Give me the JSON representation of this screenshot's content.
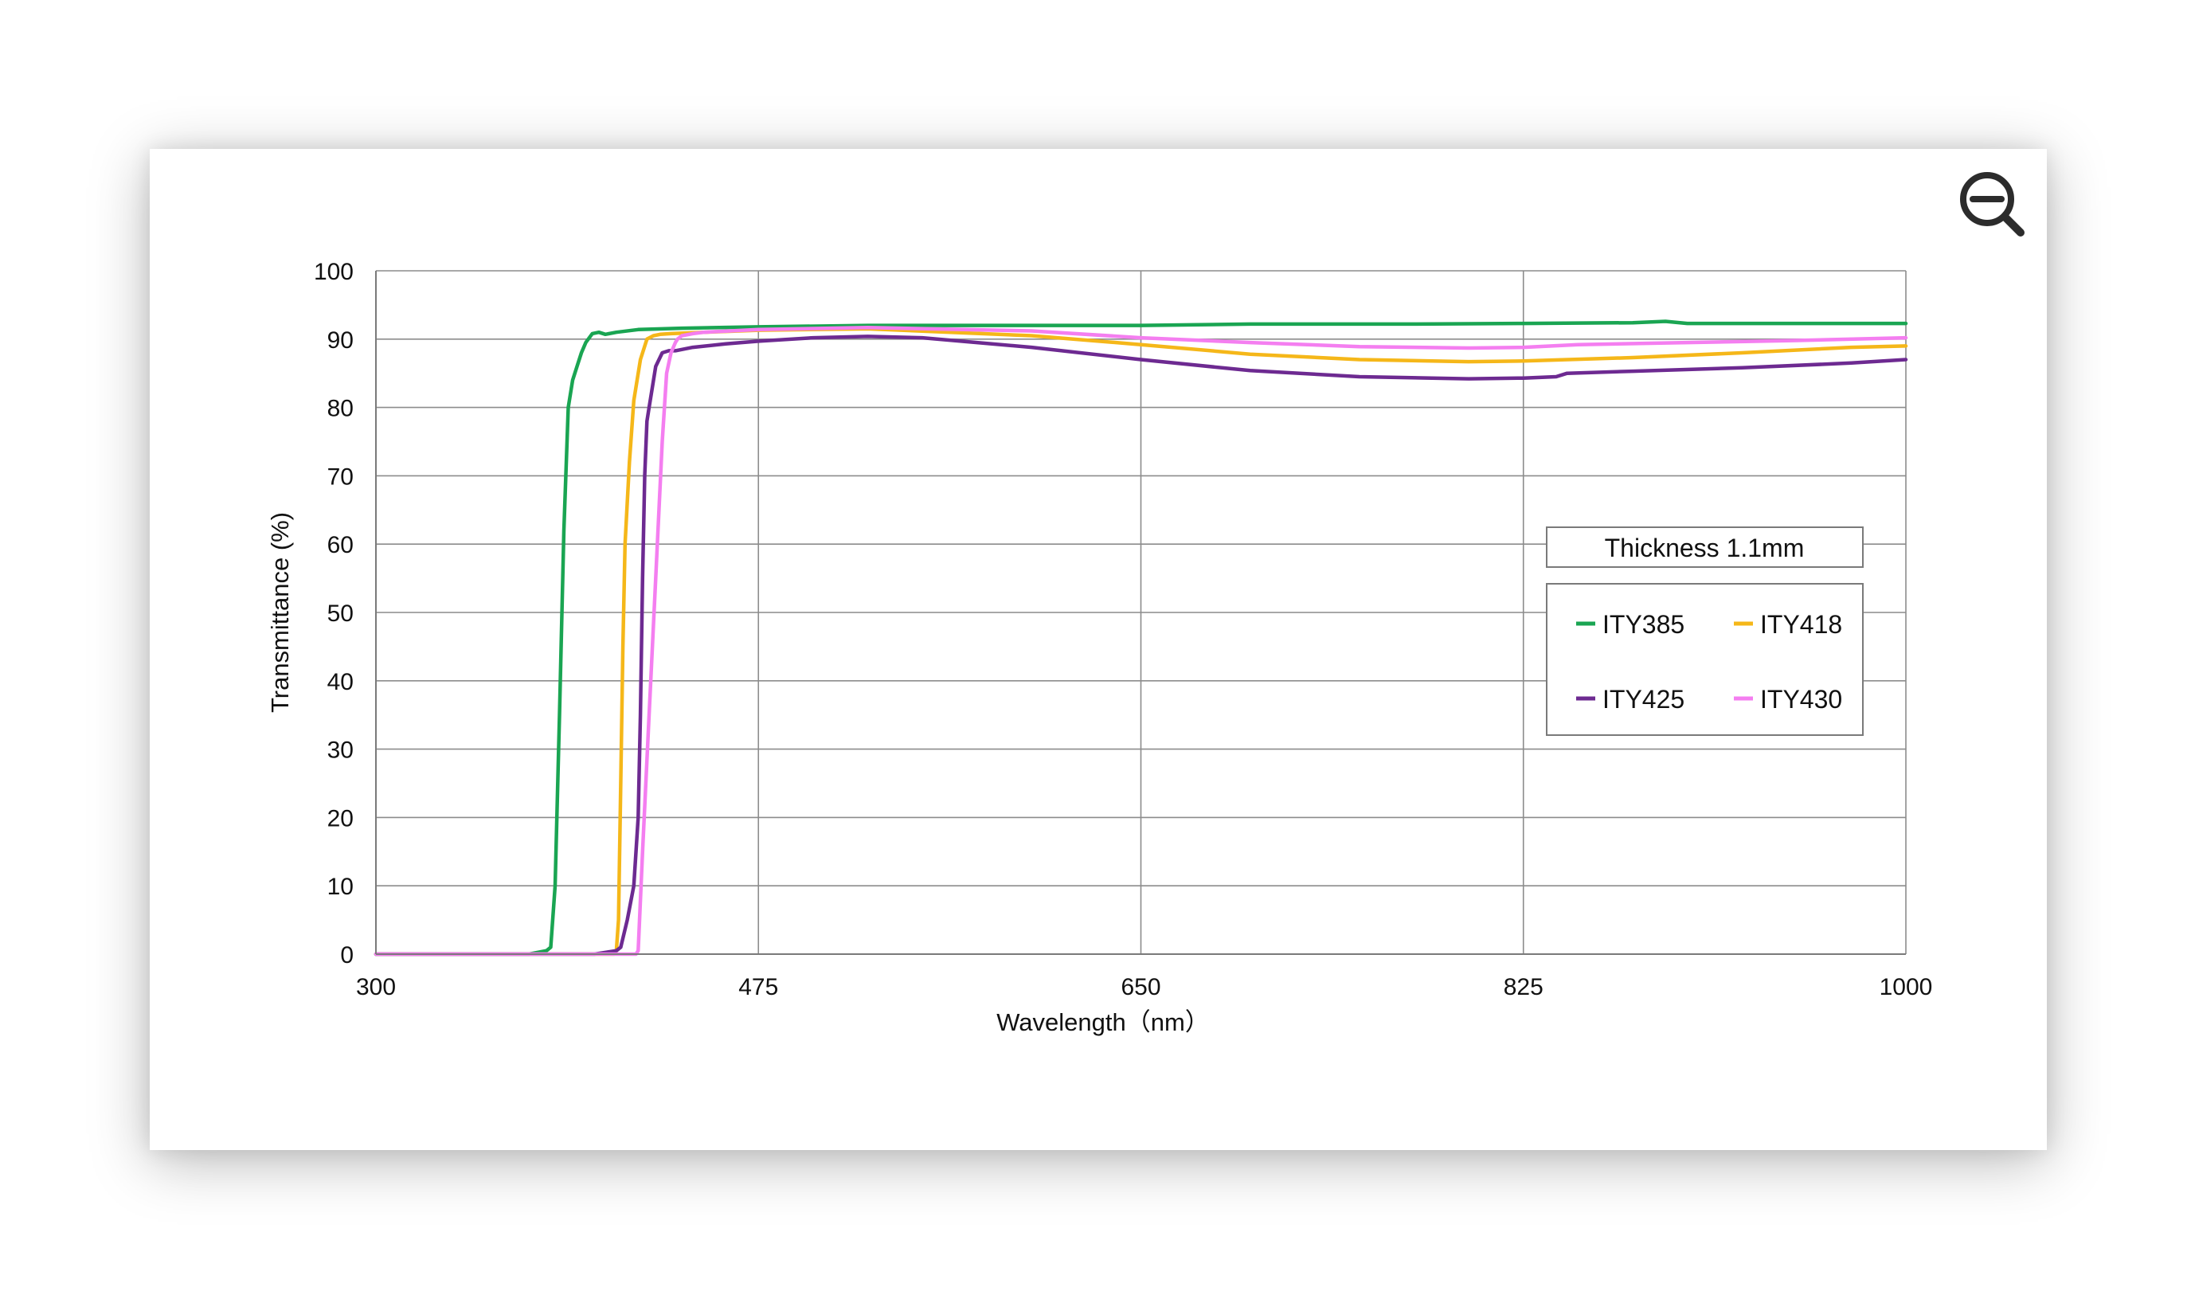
{
  "zoom_icon": "zoom-out-icon",
  "colors": {
    "grid": "#8c8c8c",
    "axis": "#7a7a7a",
    "ITY385": "#1aa552",
    "ITY418": "#f5b719",
    "ITY425": "#6d2a91",
    "ITY430": "#f47ef0"
  },
  "chart_data": {
    "type": "line",
    "xlabel": "Wavelength（nm）",
    "ylabel": "Transmittance (%)",
    "xlim": [
      300,
      1000
    ],
    "ylim": [
      0,
      100
    ],
    "xticks": [
      300,
      475,
      650,
      825,
      1000
    ],
    "yticks": [
      0,
      10,
      20,
      30,
      40,
      50,
      60,
      70,
      80,
      90,
      100
    ],
    "grid": true,
    "legend_title": "Thickness  1.1mm",
    "legend_placement": "center-right",
    "series": [
      {
        "name": "ITY385",
        "color": "#1aa552",
        "x": [
          300,
          370,
          378,
          380,
          382,
          384,
          386,
          388,
          390,
          392,
          394,
          396,
          399,
          402,
          405,
          410,
          420,
          440,
          475,
          525,
          600,
          650,
          700,
          775,
          825,
          875,
          890,
          900,
          950,
          1000
        ],
        "y": [
          0,
          0,
          0.5,
          1,
          10,
          35,
          62,
          80,
          84,
          86,
          88,
          89.5,
          90.8,
          91,
          90.7,
          91,
          91.4,
          91.6,
          91.8,
          92,
          92,
          92,
          92.2,
          92.2,
          92.3,
          92.4,
          92.6,
          92.3,
          92.3,
          92.3
        ]
      },
      {
        "name": "ITY418",
        "color": "#f5b719",
        "x": [
          300,
          400,
          409,
          410,
          411,
          412,
          413,
          414,
          416,
          418,
          421,
          424,
          427,
          430,
          435,
          450,
          475,
          525,
          600,
          650,
          700,
          750,
          800,
          825,
          875,
          925,
          975,
          1000
        ],
        "y": [
          0,
          0,
          0,
          0.5,
          5,
          25,
          45,
          60,
          72,
          81,
          87,
          90,
          90.5,
          90.7,
          90.8,
          91,
          91.3,
          91.5,
          90.5,
          89.2,
          87.8,
          87,
          86.7,
          86.8,
          87.3,
          88,
          88.8,
          89
        ]
      },
      {
        "name": "ITY425",
        "color": "#6d2a91",
        "x": [
          300,
          400,
          410,
          412,
          415,
          418,
          420,
          421,
          422,
          423,
          424,
          425,
          426,
          428,
          431,
          434,
          437,
          445,
          460,
          475,
          500,
          525,
          550,
          600,
          650,
          700,
          750,
          800,
          825,
          840,
          845,
          875,
          925,
          975,
          1000
        ],
        "y": [
          0,
          0,
          0.5,
          1,
          5,
          10,
          20,
          35,
          55,
          70,
          78,
          80,
          82,
          86,
          88,
          88.3,
          88.3,
          88.8,
          89.3,
          89.7,
          90.2,
          90.4,
          90.2,
          88.8,
          87,
          85.4,
          84.5,
          84.2,
          84.3,
          84.5,
          85,
          85.3,
          85.8,
          86.5,
          87
        ]
      },
      {
        "name": "ITY430",
        "color": "#f47ef0",
        "x": [
          300,
          400,
          419,
          420,
          422,
          425,
          428,
          431,
          433,
          435,
          437,
          438,
          440,
          445,
          450,
          475,
          525,
          600,
          650,
          700,
          750,
          800,
          825,
          850,
          900,
          950,
          1000
        ],
        "y": [
          0,
          0,
          0,
          0.5,
          15,
          35,
          55,
          75,
          85,
          88,
          89.5,
          90,
          90.5,
          90.8,
          91,
          91.4,
          91.7,
          91.2,
          90.2,
          89.5,
          88.9,
          88.7,
          88.8,
          89.2,
          89.5,
          89.8,
          90.2
        ]
      }
    ]
  }
}
